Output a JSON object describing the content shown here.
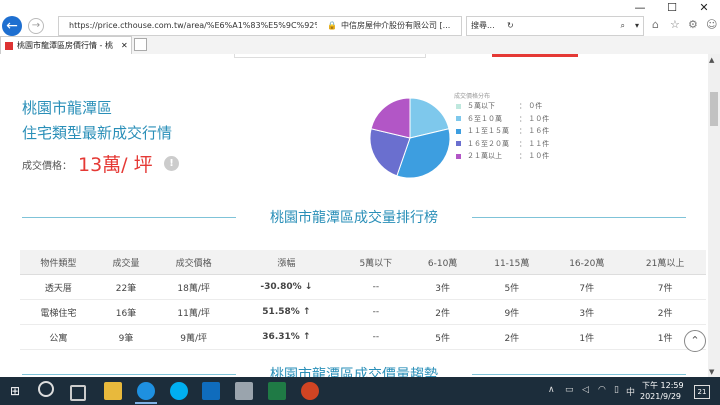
{
  "browser": {
    "address_url": "https://price.cthouse.com.tw/area/%E6%A1%83%E5%9C%92%E5%",
    "site_identity": "中信房屋仲介股份有限公司 [...",
    "search_placeholder": "搜尋...",
    "tab_title": "桃園市龍潭區房價行情 - 桃...",
    "window_controls": [
      "minimize-icon",
      "maximize-icon",
      "close-icon"
    ]
  },
  "summary": {
    "district": "桃園市龍潭區",
    "subtitle": "住宅類型最新成交行情",
    "price_label": "成交價格：",
    "price_value": "13萬/ 坪"
  },
  "chart_data": {
    "type": "pie",
    "title": "成交價格分布",
    "series": [
      {
        "name": "５萬以下",
        "value": 0,
        "label": "０件",
        "color": "#bfe8de"
      },
      {
        "name": "６至１０萬",
        "value": 10,
        "label": "１０件",
        "color": "#7ec8ec"
      },
      {
        "name": "１１至１５萬",
        "value": 16,
        "label": "１６件",
        "color": "#3d9ee0"
      },
      {
        "name": "１６至２０萬",
        "value": 11,
        "label": "１１件",
        "color": "#6a6fcf"
      },
      {
        "name": "２１萬以上",
        "value": 10,
        "label": "１０件",
        "color": "#b256c6"
      }
    ],
    "legend_position": "right",
    "legend_separator": "："
  },
  "ranking": {
    "title": "桃園市龍潭區成交量排行榜",
    "headers": [
      "物件類型",
      "成交量",
      "成交價格",
      "漲幅",
      "5萬以下",
      "6-10萬",
      "11-15萬",
      "16-20萬",
      "21萬以上"
    ],
    "rows": [
      {
        "type": "透天厝",
        "volume": "22筆",
        "price": "18萬/坪",
        "change": "-30.80% ↓",
        "dir": "down",
        "c1": "--",
        "c2": "3件",
        "c3": "5件",
        "c4": "7件",
        "c5": "7件"
      },
      {
        "type": "電梯住宅",
        "volume": "16筆",
        "price": "11萬/坪",
        "change": "51.58% ↑",
        "dir": "up",
        "c1": "--",
        "c2": "2件",
        "c3": "9件",
        "c4": "3件",
        "c5": "2件"
      },
      {
        "type": "公寓",
        "volume": "9筆",
        "price": "9萬/坪",
        "change": "36.31% ↑",
        "dir": "up",
        "c1": "--",
        "c2": "5件",
        "c3": "2件",
        "c4": "1件",
        "c5": "1件"
      }
    ]
  },
  "next_section": {
    "title": "桃園市龍潭區成交價量趨勢"
  },
  "taskbar": {
    "ime": "中",
    "time": "下午 12:59",
    "date": "2021/9/29",
    "notifications": "21"
  }
}
